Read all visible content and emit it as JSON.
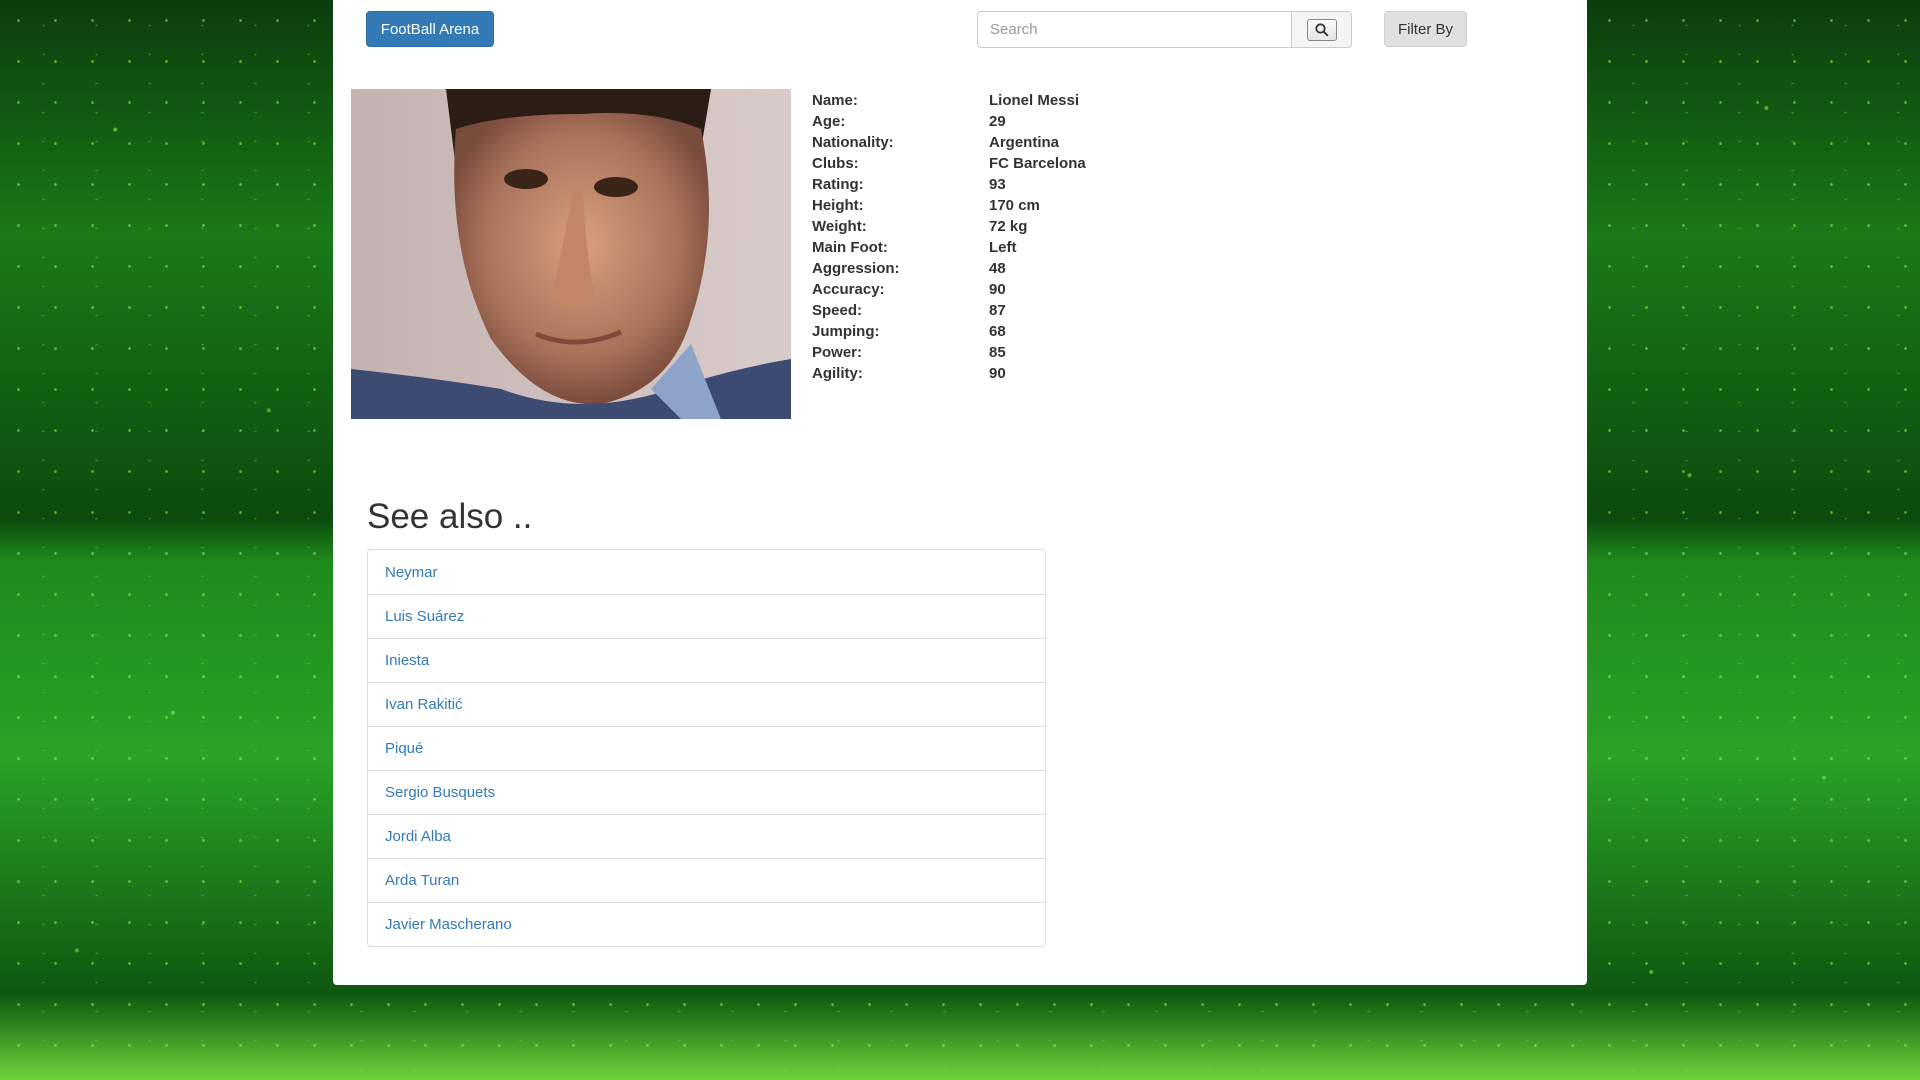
{
  "navbar": {
    "brand_label": "FootBall Arena",
    "search_placeholder": "Search",
    "filter_label": "Filter By"
  },
  "player": {
    "fields": [
      {
        "label": "Name:",
        "value": "Lionel Messi"
      },
      {
        "label": "Age:",
        "value": "29"
      },
      {
        "label": "Nationality:",
        "value": "Argentina"
      },
      {
        "label": "Clubs:",
        "value": "FC Barcelona"
      },
      {
        "label": "Rating:",
        "value": "93"
      },
      {
        "label": "Height:",
        "value": "170 cm"
      },
      {
        "label": "Weight:",
        "value": "72 kg"
      },
      {
        "label": "Main Foot:",
        "value": "Left"
      },
      {
        "label": "Aggression:",
        "value": "48"
      },
      {
        "label": "Accuracy:",
        "value": "90"
      },
      {
        "label": "Speed:",
        "value": "87"
      },
      {
        "label": "Jumping:",
        "value": "68"
      },
      {
        "label": "Power:",
        "value": "85"
      },
      {
        "label": "Agility:",
        "value": "90"
      }
    ]
  },
  "see_also": {
    "title": "See also ..",
    "items": [
      "Neymar",
      "Luis Suárez",
      "Iniesta",
      "Ivan Rakitić",
      "Piqué",
      "Sergio Busquets",
      "Jordi Alba",
      "Arda Turan",
      "Javier Mascherano"
    ]
  },
  "colors": {
    "primary": "#337ab7",
    "background_green": "#1f8a1c"
  }
}
